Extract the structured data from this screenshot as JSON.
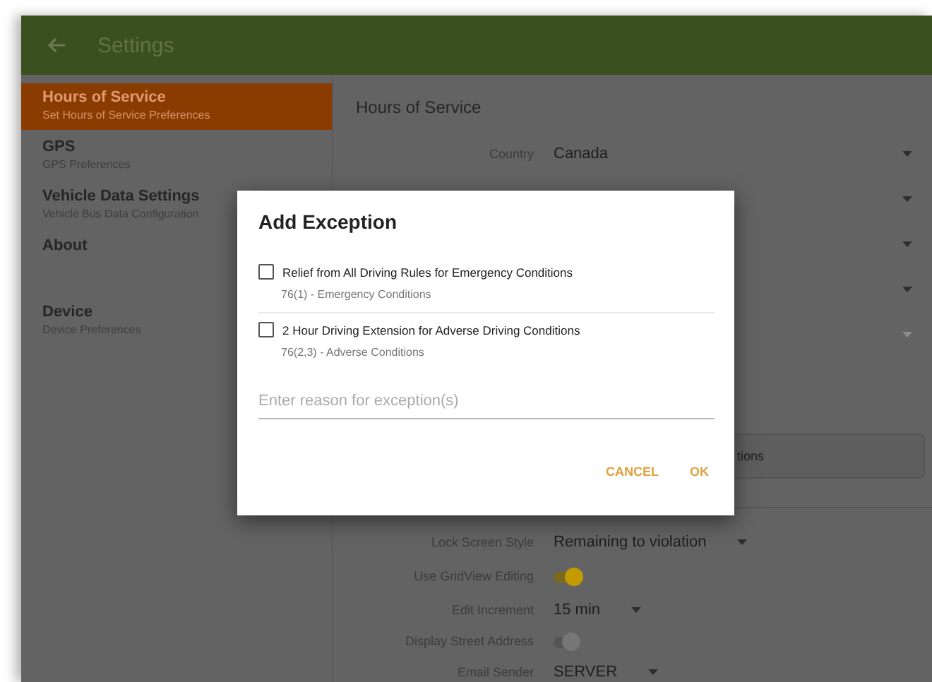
{
  "app_bar": {
    "title": "Settings"
  },
  "sidebar": {
    "items": [
      {
        "title": "Hours of Service",
        "subtitle": "Set Hours of Service Preferences",
        "selected": true
      },
      {
        "title": "GPS",
        "subtitle": "GPS Preferences",
        "selected": false
      },
      {
        "title": "Vehicle Data Settings",
        "subtitle": "Vehicle Bus Data Configuration",
        "selected": false
      },
      {
        "title": "About",
        "selected": false
      },
      {
        "title": "Device",
        "subtitle": "Device Preferences",
        "selected": false
      }
    ]
  },
  "content": {
    "heading": "Hours of Service",
    "settings_top": [
      {
        "kind": "dropdown",
        "label": "Country",
        "value": "Canada",
        "disabled": false
      },
      {
        "kind": "dropdown",
        "disabled": false
      },
      {
        "kind": "dropdown",
        "disabled": false
      },
      {
        "kind": "dropdown",
        "disabled": false
      },
      {
        "kind": "dropdown",
        "disabled": true
      }
    ],
    "button": {
      "label": "tions"
    },
    "settings_bottom": [
      {
        "kind": "dropdown",
        "label": "Lock Screen Style",
        "value": "Remaining to violation"
      },
      {
        "kind": "toggle",
        "label": "Use GridView Editing",
        "on": true
      },
      {
        "kind": "dropdown",
        "label": "Edit Increment",
        "value": "15 min"
      },
      {
        "kind": "toggle",
        "label": "Display Street Address",
        "on": false
      },
      {
        "kind": "dropdown",
        "label": "Email Sender",
        "value": "SERVER"
      }
    ]
  },
  "dialog": {
    "title": "Add Exception",
    "options": [
      {
        "title": "Relief from All Driving Rules for Emergency Conditions",
        "subtitle": "76(1) - Emergency Conditions",
        "checked": false
      },
      {
        "title": "2 Hour Driving Extension for Adverse Driving Conditions",
        "subtitle": "76(2,3) - Adverse Conditions",
        "checked": false
      }
    ],
    "reason": {
      "placeholder": "Enter reason for exception(s)"
    },
    "buttons": [
      "CANCEL",
      "OK"
    ]
  }
}
